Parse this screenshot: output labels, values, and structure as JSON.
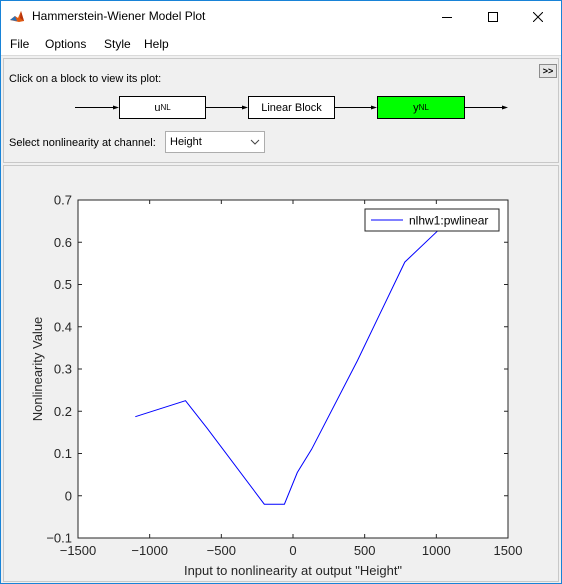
{
  "window": {
    "title": "Hammerstein-Wiener Model Plot",
    "controls": {
      "minimize": "minimize-icon",
      "maximize": "maximize-icon",
      "close": "close-icon"
    }
  },
  "menu": {
    "file": "File",
    "options": "Options",
    "style": "Style",
    "help": "Help"
  },
  "top_panel": {
    "prompt": "Click on a block to view its plot:",
    "expand_label": ">>",
    "blocks": {
      "input": {
        "main": "u",
        "sub": "NL"
      },
      "linear": {
        "label": "Linear Block"
      },
      "output": {
        "main": "y",
        "sub": "NL",
        "selected": true
      }
    },
    "channel_label": "Select nonlinearity at channel:",
    "channel_value": "Height"
  },
  "colors": {
    "selected_block": "#00ff00",
    "line": "#0000ff",
    "title_accent": "#1883d7"
  },
  "chart_data": {
    "type": "line",
    "title": "",
    "xlabel": "Input to nonlinearity at output \"Height\"",
    "ylabel": "Nonlinearity Value",
    "xlim": [
      -1500,
      1500
    ],
    "ylim": [
      -0.1,
      0.7
    ],
    "xticks": [
      -1500,
      -1000,
      -500,
      0,
      500,
      1000,
      1500
    ],
    "yticks": [
      -0.1,
      0,
      0.1,
      0.2,
      0.3,
      0.4,
      0.5,
      0.6,
      0.7
    ],
    "grid": false,
    "legend_position": "top-right",
    "series": [
      {
        "name": "nlhw1:pwlinear",
        "x": [
          -1100,
          -750,
          -600,
          -200,
          -60,
          30,
          130,
          450,
          780,
          1050
        ],
        "y": [
          0.187,
          0.225,
          0.16,
          -0.02,
          -0.02,
          0.055,
          0.11,
          0.32,
          0.553,
          0.64
        ]
      }
    ]
  }
}
